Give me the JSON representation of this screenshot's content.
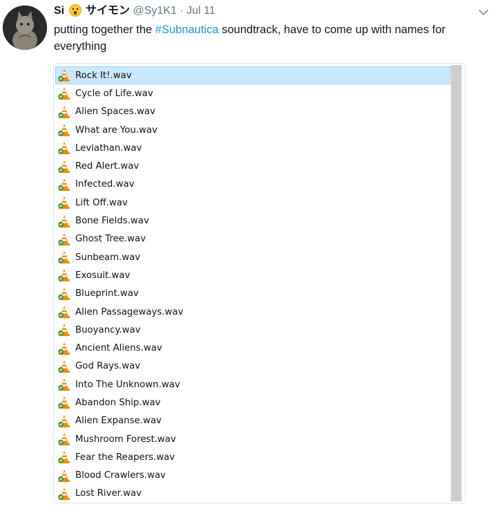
{
  "tweet": {
    "display_name": "Si",
    "emoji": "😮",
    "japanese_name": "サイモン",
    "handle": "@Sy1K1",
    "separator": "·",
    "date": "Jul 11",
    "text_before": "putting together the ",
    "hashtag": "#Subnautica",
    "text_after": " soundtrack, have to come up with names for everything"
  },
  "files": [
    "Rock It!.wav",
    "Cycle of Life.wav",
    "Alien Spaces.wav",
    "What are You.wav",
    "Leviathan.wav",
    "Red Alert.wav",
    "Infected.wav",
    "Lift Off.wav",
    "Bone Fields.wav",
    "Ghost Tree.wav",
    "Sunbeam.wav",
    "Exosuit.wav",
    "Blueprint.wav",
    "Alien Passageways.wav",
    "Buoyancy.wav",
    "Ancient Aliens.wav",
    "God Rays.wav",
    "Into The Unknown.wav",
    "Abandon Ship.wav",
    "Alien Expanse.wav",
    "Mushroom Forest.wav",
    "Fear the Reapers.wav",
    "Blood Crawlers.wav",
    "Lost River.wav"
  ],
  "selected_file": "Rock It!.wav",
  "icons": {
    "file": "vlc-cone-icon",
    "menu": "chevron-down-icon"
  },
  "colors": {
    "hashtag": "#1b95e0",
    "selection": "#cce8ff",
    "muted": "#657786"
  }
}
